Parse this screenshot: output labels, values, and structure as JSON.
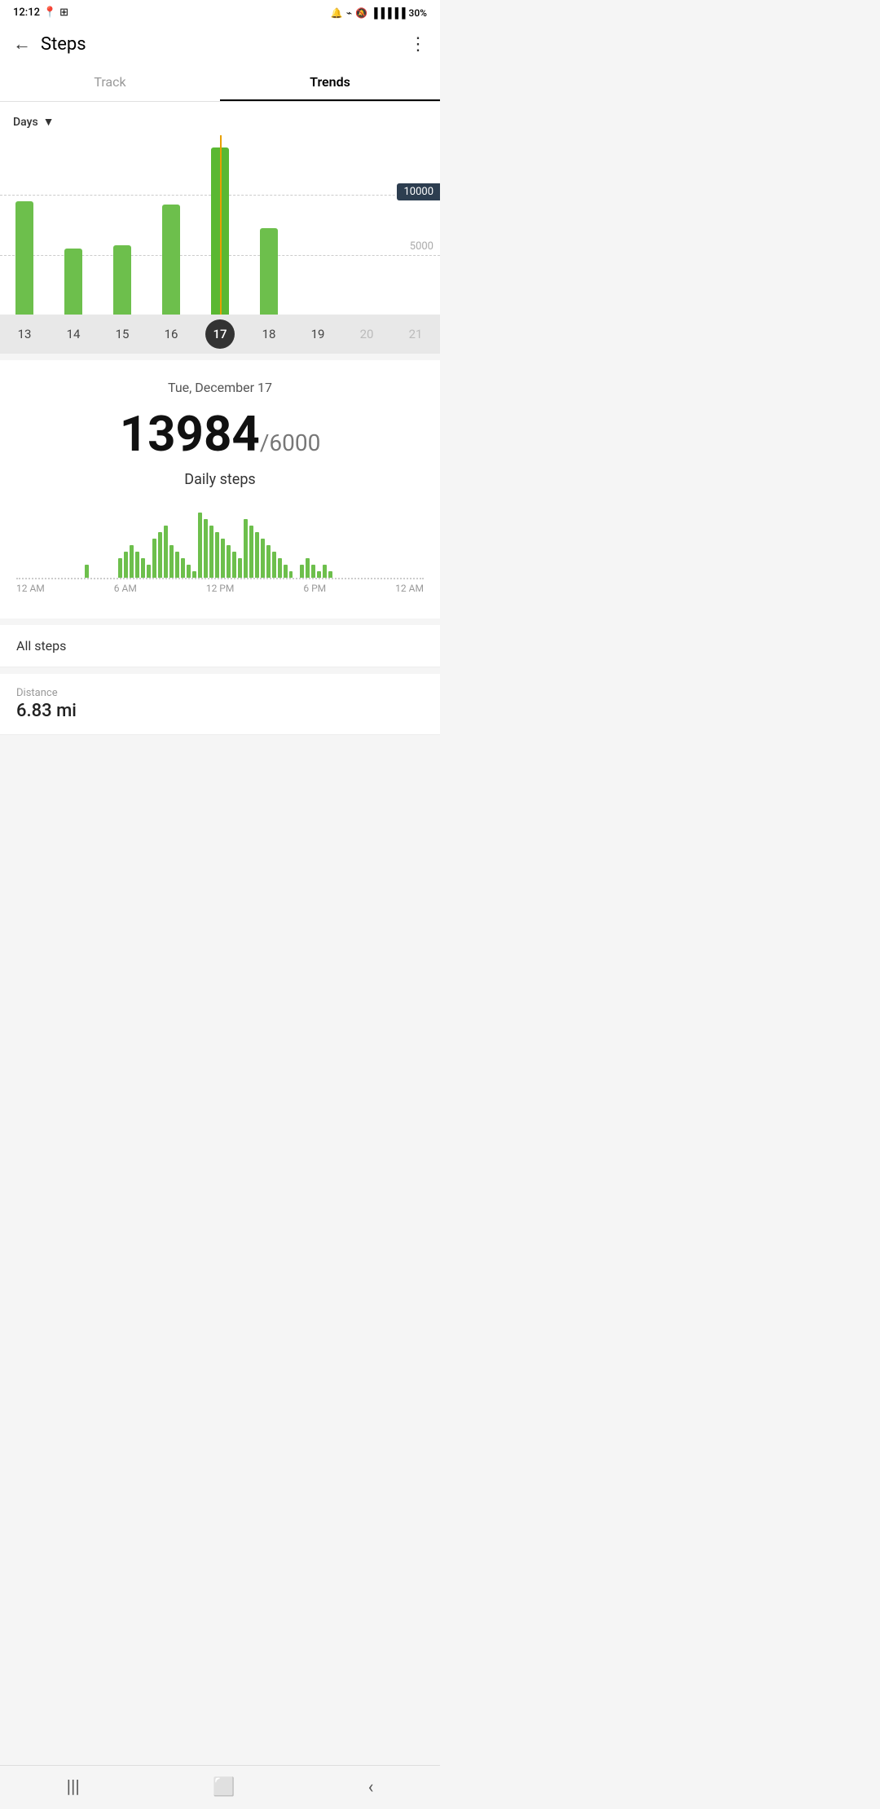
{
  "statusBar": {
    "time": "12:12",
    "battery": "30%",
    "icons": [
      "alarm",
      "bluetooth",
      "mute",
      "4g",
      "signal"
    ]
  },
  "header": {
    "title": "Steps",
    "backLabel": "←",
    "menuLabel": "⋮"
  },
  "tabs": [
    {
      "id": "track",
      "label": "Track",
      "active": false
    },
    {
      "id": "trends",
      "label": "Trends",
      "active": true
    }
  ],
  "chart": {
    "periodLabel": "Days",
    "goalValue": 10000,
    "goal2Value": 5000,
    "selectedDate": "Tue, December 17",
    "selectedIndex": 4,
    "xLabels": [
      "13",
      "14",
      "15",
      "16",
      "17",
      "18",
      "19",
      "20",
      "21"
    ],
    "xFaded": [
      7,
      8
    ],
    "bars": [
      {
        "value": 9500
      },
      {
        "value": 5500
      },
      {
        "value": 5800
      },
      {
        "value": 9200
      },
      {
        "value": 13984
      },
      {
        "value": 7200
      },
      {
        "value": 0
      },
      {
        "value": 0
      },
      {
        "value": 0
      }
    ],
    "maxValue": 15000
  },
  "detail": {
    "date": "Tue, December 17",
    "steps": "13984",
    "goal": "/6000",
    "stepsLabel": "Daily steps"
  },
  "hourlyChart": {
    "timeLabels": [
      "12 AM",
      "6 AM",
      "12 PM",
      "6 PM",
      "12 AM"
    ],
    "bars": [
      0,
      0,
      0,
      0,
      0,
      0,
      0,
      0,
      0,
      0,
      0,
      0,
      2,
      0,
      0,
      0,
      0,
      0,
      3,
      4,
      5,
      4,
      3,
      2,
      6,
      7,
      8,
      5,
      4,
      3,
      2,
      1,
      10,
      9,
      8,
      7,
      6,
      5,
      4,
      3,
      9,
      8,
      7,
      6,
      5,
      4,
      3,
      2,
      1,
      0,
      2,
      3,
      2,
      1,
      2,
      1,
      0,
      0,
      0,
      0,
      0,
      0,
      0,
      0,
      0,
      0,
      0,
      0,
      0,
      0,
      0,
      0
    ]
  },
  "allStepsLabel": "All steps",
  "stats": [
    {
      "label": "Distance",
      "value": "6.83 mi"
    }
  ],
  "bottomNav": {
    "icons": [
      "|||",
      "⬜",
      "‹"
    ]
  }
}
